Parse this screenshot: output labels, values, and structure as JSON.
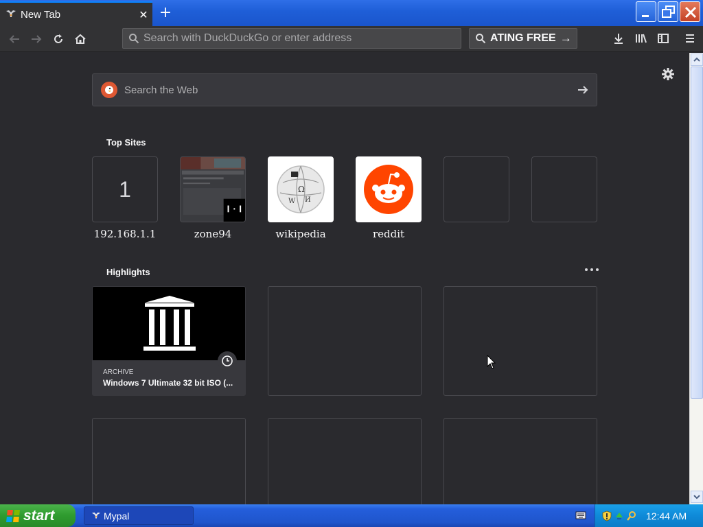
{
  "window": {
    "tab_title": "New Tab",
    "new_tab_symbol": "+"
  },
  "toolbar": {
    "url_placeholder": "Search with DuckDuckGo or enter address",
    "search_text": "ATING FREE",
    "search_arrow": "→"
  },
  "newtab": {
    "web_search_placeholder": "Search the Web",
    "top_sites_title": "Top Sites",
    "top_sites": [
      {
        "label": "192.168.1.1",
        "tile_text": "1"
      },
      {
        "label": "zone94"
      },
      {
        "label": "wikipedia"
      },
      {
        "label": "reddit"
      },
      {
        "label": ""
      },
      {
        "label": ""
      }
    ],
    "highlights_title": "Highlights",
    "highlights": [
      {
        "source": "ARCHIVE",
        "title": "Windows 7 Ultimate 32 bit ISO (..."
      }
    ]
  },
  "taskbar": {
    "start_label": "start",
    "active_window": "Mypal",
    "clock": "12:44 AM"
  },
  "colors": {
    "background": "#2a2a2e",
    "accent": "#0a84ff",
    "reddit": "#ff4500",
    "duckduckgo": "#de5833"
  }
}
